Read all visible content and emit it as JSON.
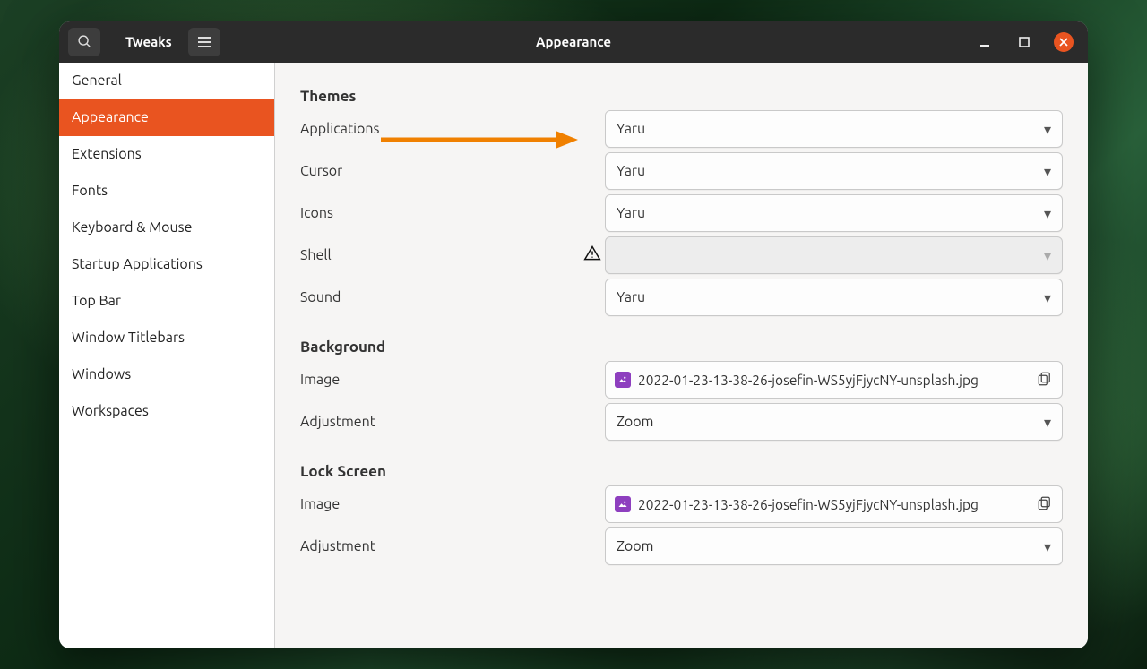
{
  "titlebar": {
    "app_title": "Tweaks",
    "window_title": "Appearance"
  },
  "sidebar": {
    "items": [
      {
        "label": "General"
      },
      {
        "label": "Appearance"
      },
      {
        "label": "Extensions"
      },
      {
        "label": "Fonts"
      },
      {
        "label": "Keyboard & Mouse"
      },
      {
        "label": "Startup Applications"
      },
      {
        "label": "Top Bar"
      },
      {
        "label": "Window Titlebars"
      },
      {
        "label": "Windows"
      },
      {
        "label": "Workspaces"
      }
    ],
    "selected_index": 1
  },
  "sections": {
    "themes": {
      "title": "Themes",
      "rows": {
        "applications": {
          "label": "Applications",
          "value": "Yaru"
        },
        "cursor": {
          "label": "Cursor",
          "value": "Yaru"
        },
        "icons": {
          "label": "Icons",
          "value": "Yaru"
        },
        "shell": {
          "label": "Shell",
          "value": ""
        },
        "sound": {
          "label": "Sound",
          "value": "Yaru"
        }
      }
    },
    "background": {
      "title": "Background",
      "rows": {
        "image": {
          "label": "Image",
          "value": "2022-01-23-13-38-26-josefin-WS5yjFjycNY-unsplash.jpg"
        },
        "adjustment": {
          "label": "Adjustment",
          "value": "Zoom"
        }
      }
    },
    "lockscreen": {
      "title": "Lock Screen",
      "rows": {
        "image": {
          "label": "Image",
          "value": "2022-01-23-13-38-26-josefin-WS5yjFjycNY-unsplash.jpg"
        },
        "adjustment": {
          "label": "Adjustment",
          "value": "Zoom"
        }
      }
    }
  }
}
